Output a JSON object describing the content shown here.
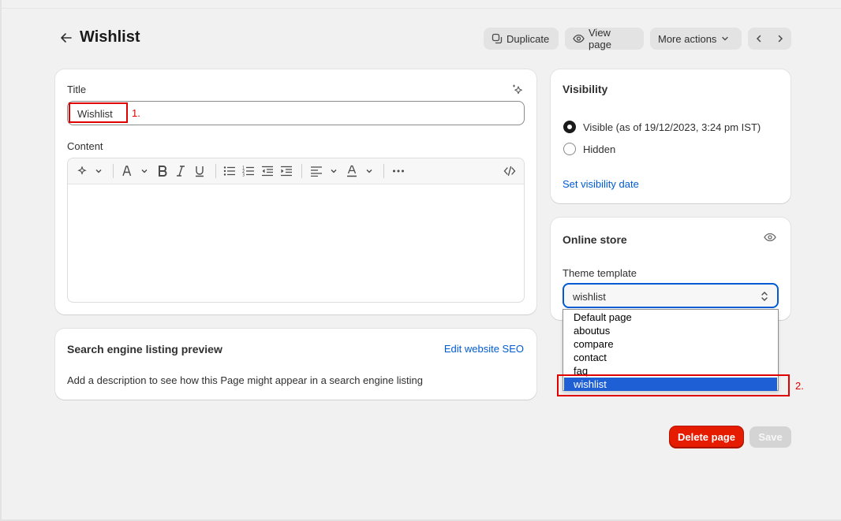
{
  "header": {
    "title": "Wishlist",
    "duplicate_label": "Duplicate",
    "view_page_label": "View page",
    "more_actions_label": "More actions"
  },
  "title_card": {
    "title_label": "Title",
    "title_value": "Wishlist",
    "content_label": "Content"
  },
  "seo_card": {
    "heading": "Search engine listing preview",
    "edit_link": "Edit website SEO",
    "description": "Add a description to see how this Page might appear in a search engine listing"
  },
  "visibility_card": {
    "heading": "Visibility",
    "visible_label": "Visible (as of 19/12/2023, 3:24 pm IST)",
    "hidden_label": "Hidden",
    "set_date_link": "Set visibility date",
    "selected": "visible"
  },
  "online_store_card": {
    "heading": "Online store",
    "template_label": "Theme template",
    "template_value": "wishlist"
  },
  "dropdown": {
    "options": [
      "Default page",
      "aboutus",
      "compare",
      "contact",
      "faq",
      "wishlist"
    ],
    "selected": "wishlist"
  },
  "annotations": {
    "first": "1.",
    "second": "2."
  },
  "footer": {
    "delete_label": "Delete page",
    "save_label": "Save"
  },
  "colors": {
    "accent": "#005bd3",
    "delete": "#e51c00",
    "annotation": "#e00000",
    "selected_option": "#1f5fd6"
  }
}
